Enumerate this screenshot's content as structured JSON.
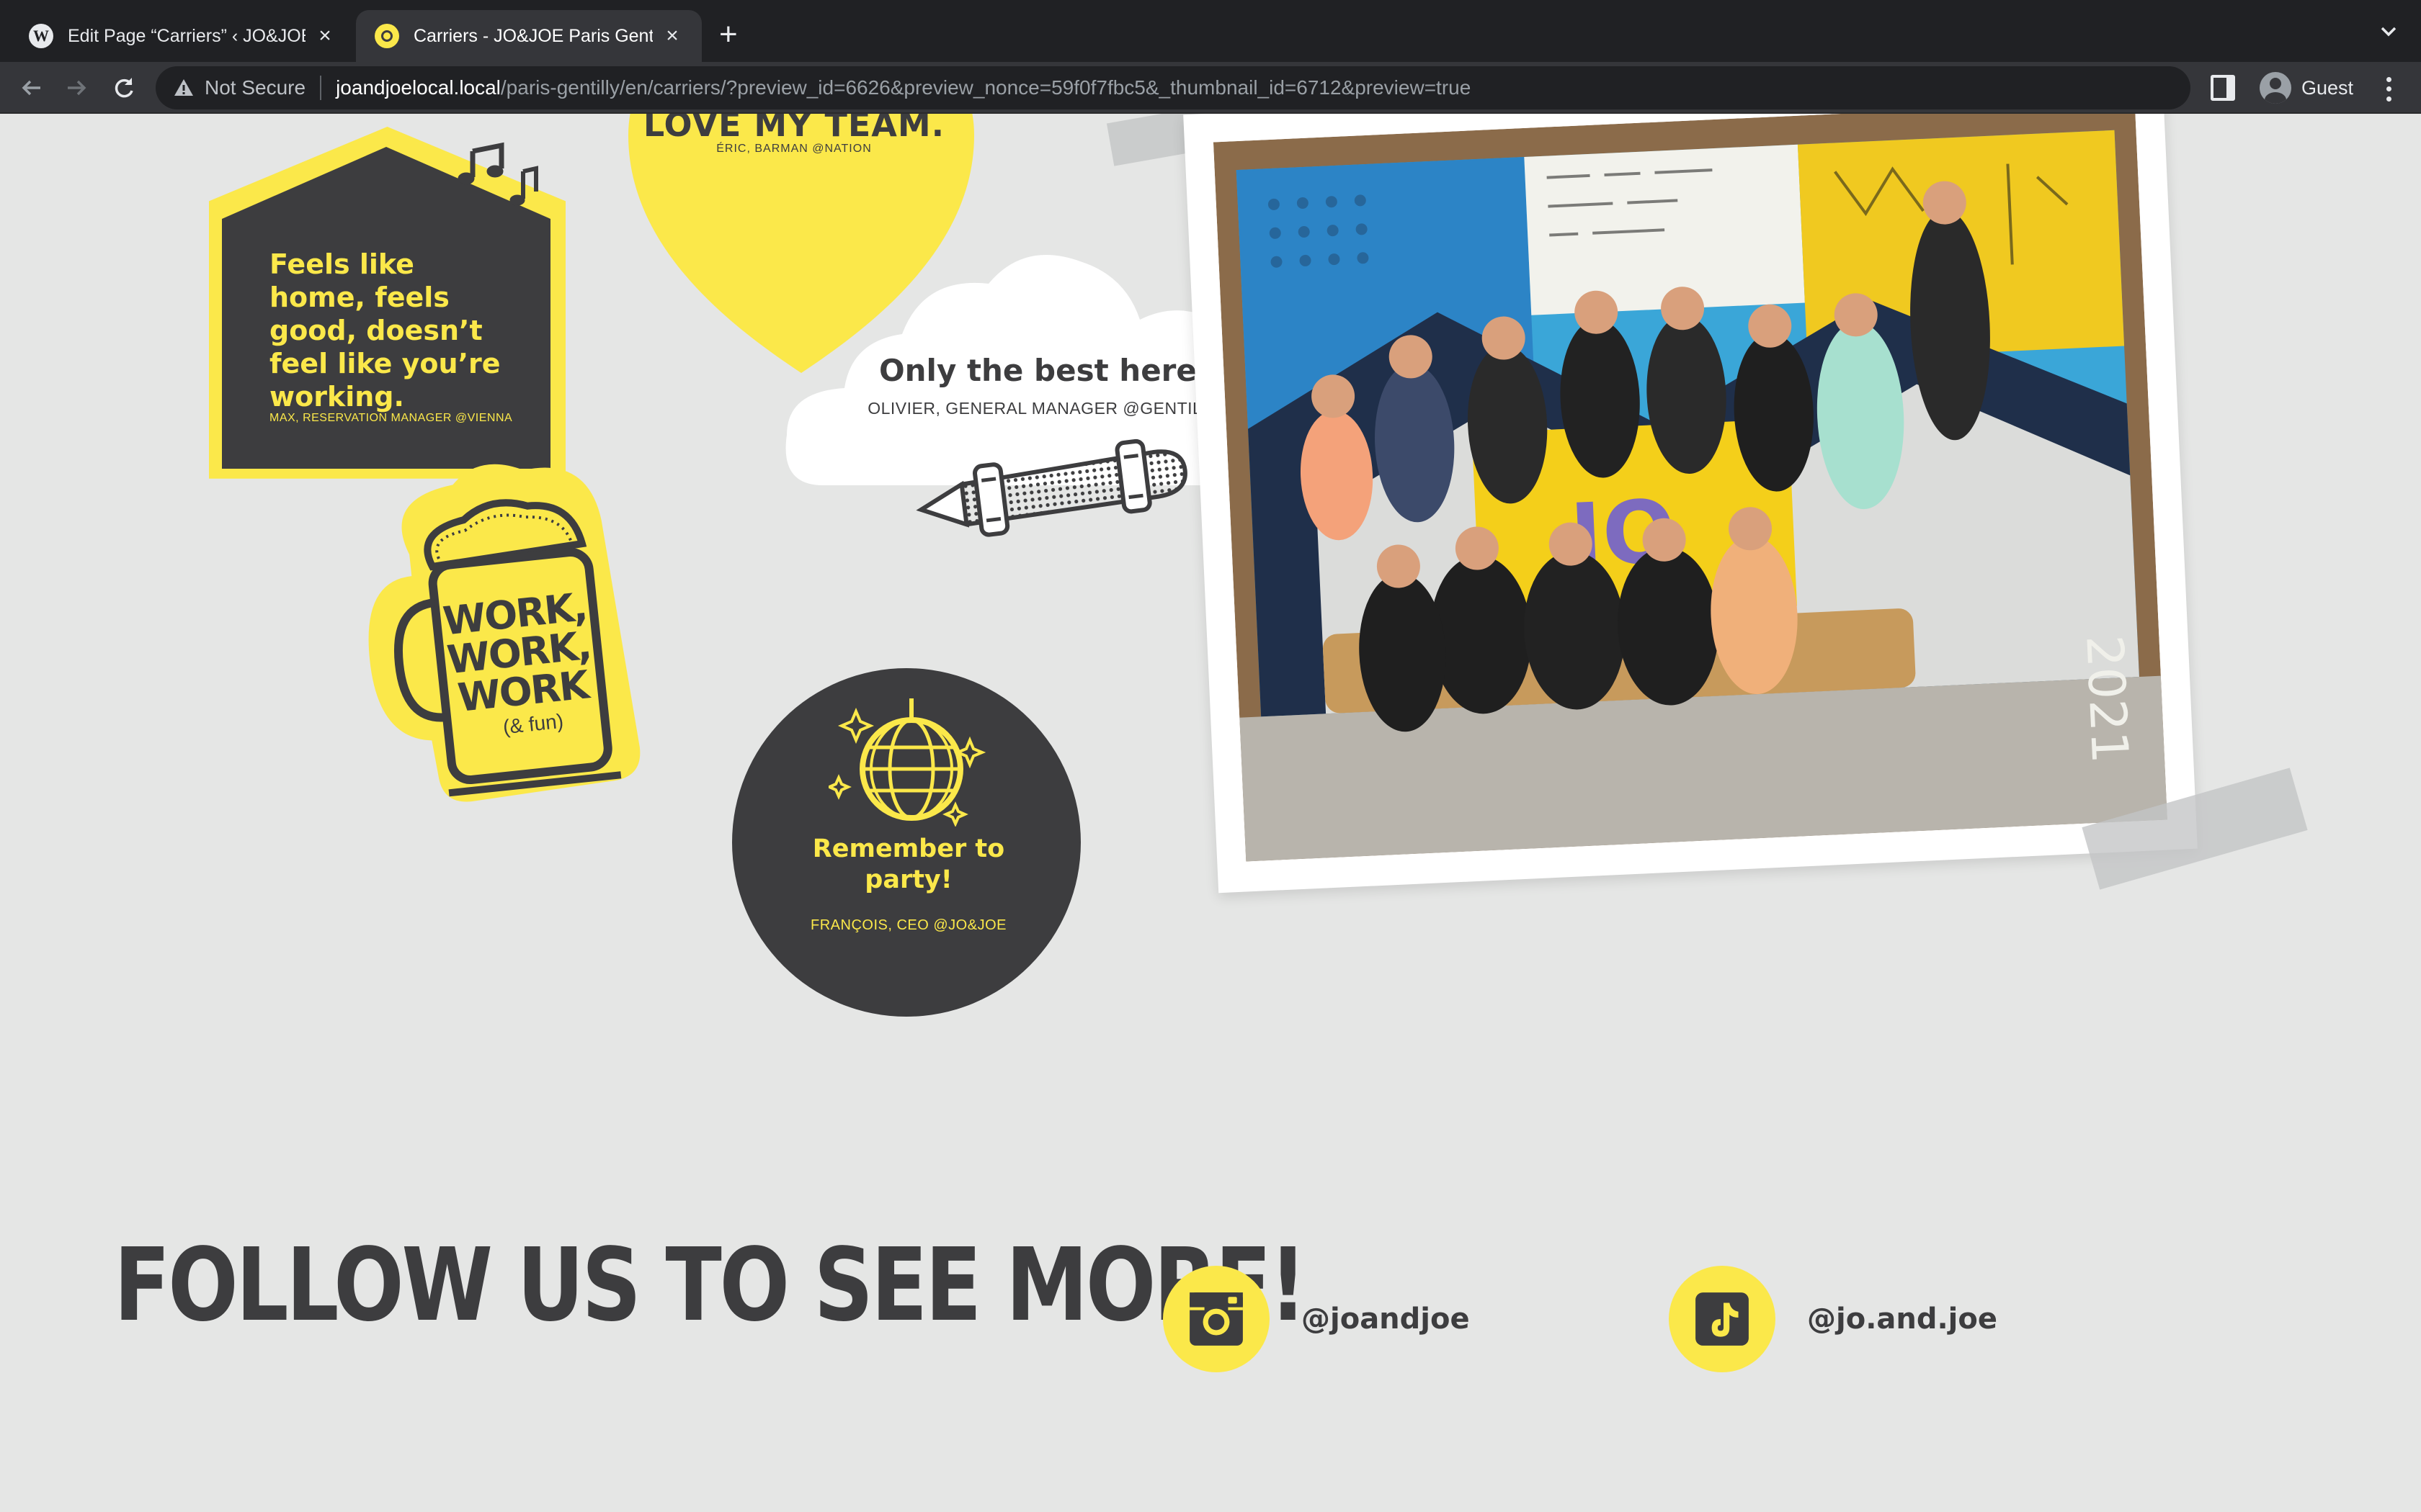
{
  "browser": {
    "tabs": [
      {
        "title": "Edit Page “Carriers” ‹ JO&JOE",
        "favicon": "wordpress-icon",
        "active": false
      },
      {
        "title": "Carriers - JO&JOE Paris Gentilly",
        "favicon": "jo-and-joe-icon",
        "active": true
      }
    ],
    "security_label": "Not Secure",
    "url_host": "joandjoelocal.local",
    "url_path": "/paris-gentilly/en/carriers/?preview_id=6626&preview_nonce=59f0f7fbc5&_thumbnail_id=6712&preview=true",
    "profile_name": "Guest"
  },
  "colors": {
    "brand_yellow": "#fbe84a",
    "charcoal": "#3d3d3f",
    "page_bg": "#e5e6e5"
  },
  "stickers": {
    "heart": {
      "title": "LOVE MY TEAM.",
      "author": "ÉRIC,  BARMAN @NATION"
    },
    "house": {
      "quote": "Feels like home, feels good, doesn’t feel like you’re working.",
      "author": "MAX, RESERVATION MANAGER @VIENNA"
    },
    "cloud": {
      "title": "Only the best here!",
      "author": "OLIVIER, GENERAL MANAGER @GENTILLY"
    },
    "mug": {
      "text": "WORK, WORK, WORK",
      "sub": "(& fun)"
    },
    "disc": {
      "title": "Remember to party!",
      "author": "FRANÇOIS, CEO @JO&JOE"
    }
  },
  "photo": {
    "flag_text": "JO",
    "wall_text": "2021",
    "description_icon": "team-photo"
  },
  "follow": {
    "title": "FOLLOW US TO SEE MORE!",
    "instagram": {
      "icon": "instagram-icon",
      "handle": "@joandjoe"
    },
    "tiktok": {
      "icon": "tiktok-icon",
      "handle": "@jo.and.joe"
    }
  }
}
